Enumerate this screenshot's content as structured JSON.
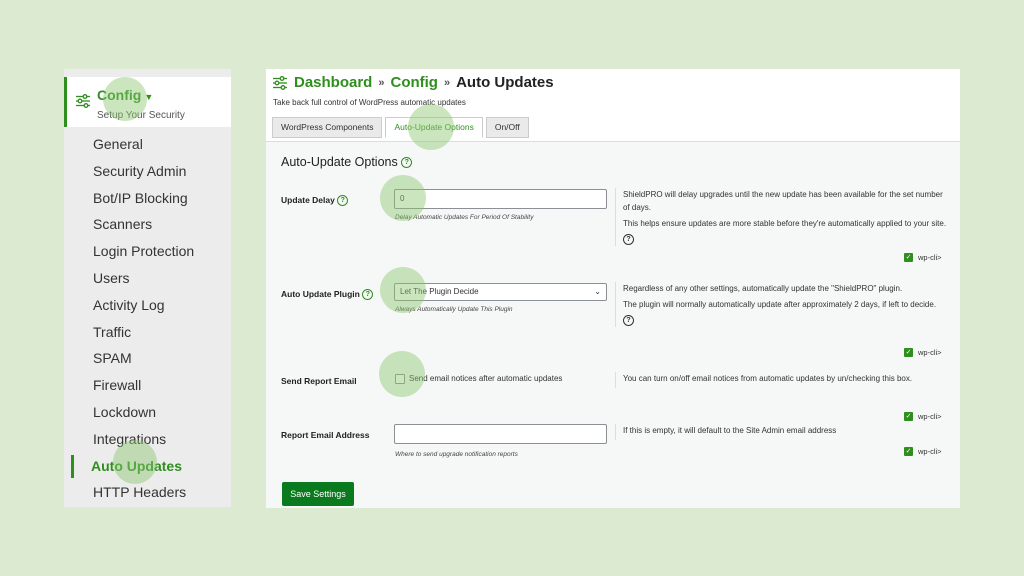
{
  "sidebar": {
    "header_title": "Config",
    "header_subtitle": "Setup Your Security",
    "items": [
      {
        "label": "General"
      },
      {
        "label": "Security Admin"
      },
      {
        "label": "Bot/IP Blocking"
      },
      {
        "label": "Scanners"
      },
      {
        "label": "Login Protection"
      },
      {
        "label": "Users"
      },
      {
        "label": "Activity Log"
      },
      {
        "label": "Traffic"
      },
      {
        "label": "SPAM"
      },
      {
        "label": "Firewall"
      },
      {
        "label": "Lockdown"
      },
      {
        "label": "Integrations"
      },
      {
        "label": "Auto Updates"
      },
      {
        "label": "HTTP Headers"
      }
    ],
    "active_item": "Auto Updates"
  },
  "header": {
    "breadcrumb": [
      "Dashboard",
      "Config",
      "Auto Updates"
    ],
    "separator": "»",
    "tagline": "Take back full control of WordPress automatic updates"
  },
  "tabs": [
    {
      "label": "WordPress Components",
      "active": false
    },
    {
      "label": "Auto-Update Options",
      "active": true
    },
    {
      "label": "On/Off",
      "active": false
    }
  ],
  "section": {
    "title": "Auto-Update Options"
  },
  "rows": {
    "delay": {
      "label": "Update Delay",
      "value": "0",
      "help": "Delay Automatic Updates For Period Of Stability",
      "desc1": "ShieldPRO will delay upgrades until the new update has been available for the set number of days.",
      "desc2": "This helps ensure updates are more stable before they're automatically applied to your site."
    },
    "plugin": {
      "label": "Auto Update Plugin",
      "value": "Let The Plugin Decide",
      "help": "Always Automatically Update This Plugin",
      "desc1": "Regardless of any other settings, automatically update the \"ShieldPRO\" plugin.",
      "desc2": "The plugin will normally automatically update after approximately 2 days, if left to decide."
    },
    "report": {
      "label": "Send Report Email",
      "checkbox_label": "Send email notices after automatic updates",
      "desc1": "You can turn on/off email notices from automatic updates by un/checking this box."
    },
    "address": {
      "label": "Report Email Address",
      "value": "",
      "help": "Where to send upgrade notification reports",
      "desc1": "If this is empty, it will default to the Site Admin email address"
    }
  },
  "wpcli_label": "wp-cli>",
  "save_label": "Save Settings",
  "colors": {
    "accent": "#2f8f1e",
    "button": "#0a7a1e",
    "page_bg": "#dcead2",
    "highlight": "#8cc86e"
  }
}
